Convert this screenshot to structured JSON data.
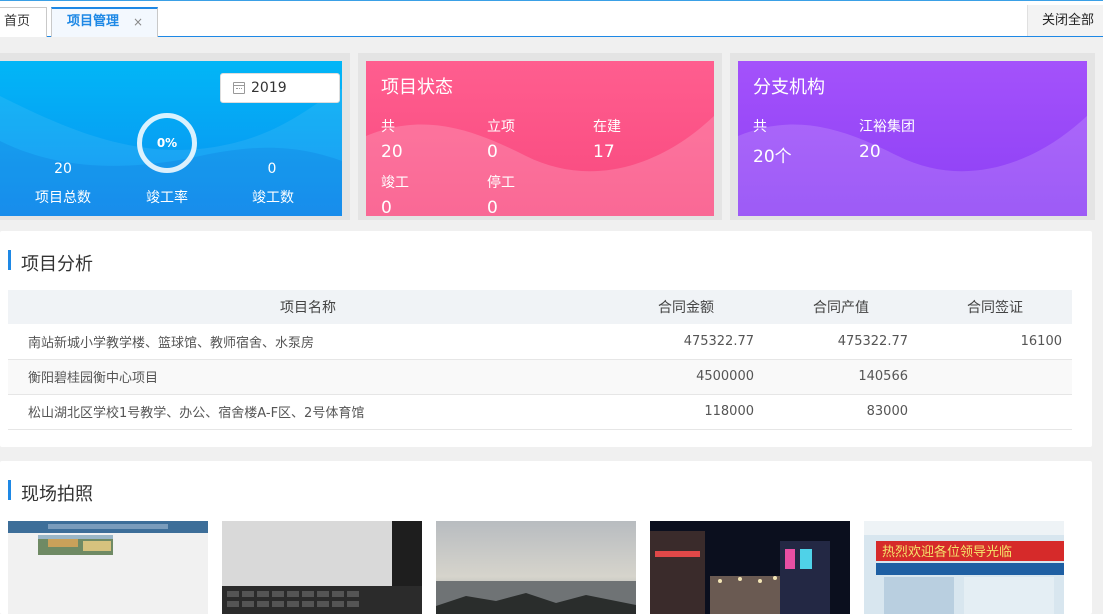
{
  "tabs": {
    "home": "首页",
    "active": "项目管理",
    "close_glyph": "×",
    "close_all": "关闭全部"
  },
  "summary": {
    "year": "2019",
    "completion_rate": "0%",
    "total_value": "20",
    "total_label": "项目总数",
    "rate_label": "竣工率",
    "completed_value": "0",
    "completed_label": "竣工数"
  },
  "status": {
    "title": "项目状态",
    "items": [
      {
        "label": "共",
        "value": "20"
      },
      {
        "label": "立项",
        "value": "0"
      },
      {
        "label": "在建",
        "value": "17"
      },
      {
        "label": "竣工",
        "value": "0"
      },
      {
        "label": "停工",
        "value": "0"
      }
    ]
  },
  "branch": {
    "title": "分支机构",
    "items": [
      {
        "label": "共",
        "value": "20个"
      },
      {
        "label": "江裕集团",
        "value": "20"
      }
    ]
  },
  "analysis": {
    "title": "项目分析",
    "columns": [
      "项目名称",
      "合同金额",
      "合同产值",
      "合同签证"
    ],
    "rows": [
      {
        "name": "南站新城小学教学楼、篮球馆、教师宿舍、水泵房",
        "amount": "475322.77",
        "output": "475322.77",
        "visa": "16100"
      },
      {
        "name": "衡阳碧桂园衡中心项目",
        "amount": "4500000",
        "output": "140566",
        "visa": ""
      },
      {
        "name": "松山湖北区学校1号教学、办公、宿舍楼A-F区、2号体育馆",
        "amount": "118000",
        "output": "83000",
        "visa": ""
      }
    ]
  },
  "photos": {
    "title": "现场拍照",
    "banner_text": "热烈欢迎各位领导光临"
  },
  "colors": {
    "accent": "#1e88e5",
    "card_blue": "#0a8ff0",
    "card_pink": "#f8487e",
    "card_purple": "#8c3ff5",
    "link_orange": "#e58a2c"
  }
}
